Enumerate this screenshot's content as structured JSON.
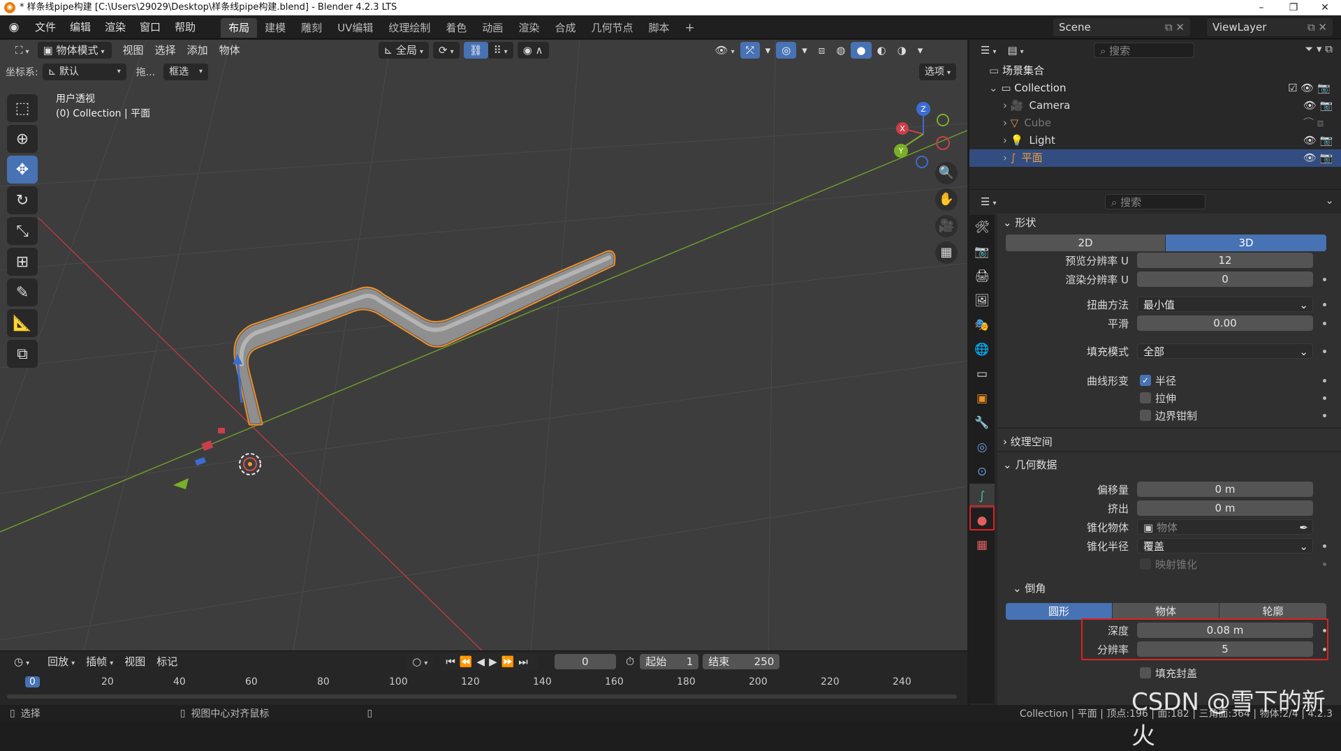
{
  "window": {
    "title": "* 样条线pipe构建 [C:\\Users\\29029\\Desktop\\样条线pipe构建.blend] - Blender 4.2.3 LTS",
    "controls": [
      "–",
      "❐",
      "✕"
    ]
  },
  "menu": [
    "文件",
    "编辑",
    "渲染",
    "窗口",
    "帮助"
  ],
  "workspaces": [
    "布局",
    "建模",
    "雕刻",
    "UV编辑",
    "纹理绘制",
    "着色",
    "动画",
    "渲染",
    "合成",
    "几何节点",
    "脚本"
  ],
  "active_workspace": "布局",
  "scene": {
    "name": "Scene",
    "view_layer": "ViewLayer"
  },
  "viewport": {
    "mode": "物体模式",
    "menus": [
      "视图",
      "选择",
      "添加",
      "物体"
    ],
    "transform_orientation": "全局",
    "options_label": "选项",
    "coord_label": "坐标系:",
    "coord_value": "默认",
    "drag_label": "拖...",
    "select_mode": "框选",
    "overlay_title": "用户透视",
    "overlay_subtitle": "(0) Collection | 平面",
    "gizmo_axes": {
      "x": "X",
      "y": "Y",
      "z": "Z"
    }
  },
  "timeline": {
    "menus": [
      "回放",
      "插帧",
      "视图",
      "标记"
    ],
    "current_frame": "0",
    "start_label": "起始",
    "start_value": "1",
    "end_label": "结束",
    "end_value": "250",
    "ruler": [
      "0",
      "20",
      "40",
      "60",
      "80",
      "100",
      "120",
      "140",
      "160",
      "180",
      "200",
      "220",
      "240"
    ]
  },
  "status": {
    "left": "选择",
    "middle": "视图中心对齐鼠标",
    "right": "Collection | 平面 | 顶点:196 | 面:182 | 三角面:364 | 物体:2/4 | 4.2.3"
  },
  "watermark": "CSDN @雪下的新火",
  "outliner": {
    "search_placeholder": "搜索",
    "root": "场景集合",
    "collection": "Collection",
    "items": [
      {
        "name": "Camera",
        "selected": false,
        "dim": false,
        "icon": "camera-icon"
      },
      {
        "name": "Cube",
        "selected": false,
        "dim": true,
        "icon": "mesh-icon"
      },
      {
        "name": "Light",
        "selected": false,
        "dim": false,
        "icon": "light-icon"
      },
      {
        "name": "平面",
        "selected": true,
        "dim": false,
        "icon": "curve-icon"
      }
    ]
  },
  "properties": {
    "search_placeholder": "搜索",
    "shape": {
      "title": "形状",
      "dim_2d": "2D",
      "dim_3d": "3D",
      "preview_u_label": "预览分辨率 U",
      "preview_u": "12",
      "render_u_label": "渲染分辨率 U",
      "render_u": "0",
      "twist_label": "扭曲方法",
      "twist_value": "最小值",
      "smooth_label": "平滑",
      "smooth_value": "0.00",
      "fill_label": "填充模式",
      "fill_value": "全部",
      "deform_label": "曲线形变",
      "radius_label": "半径",
      "stretch_label": "拉伸",
      "clamp_label": "边界钳制"
    },
    "texture_space": "纹理空间",
    "geometry": {
      "title": "几何数据",
      "offset_label": "偏移量",
      "offset": "0 m",
      "extrude_label": "挤出",
      "extrude": "0 m",
      "taper_obj_label": "锥化物体",
      "taper_obj_placeholder": "物体",
      "taper_radius_label": "锥化半径",
      "taper_radius_value": "覆盖",
      "map_taper_label": "映射锥化"
    },
    "bevel": {
      "title": "倒角",
      "modes": [
        "圆形",
        "物体",
        "轮廓"
      ],
      "depth_label": "深度",
      "depth": "0.08 m",
      "resolution_label": "分辨率",
      "resolution": "5",
      "fill_caps_label": "填充封盖"
    }
  },
  "colors": {
    "accent": "#4772b3",
    "selection_orange": "#f0902a",
    "highlight_red": "#e02020",
    "x_axis": "#c8404a",
    "y_axis": "#7ab028"
  }
}
